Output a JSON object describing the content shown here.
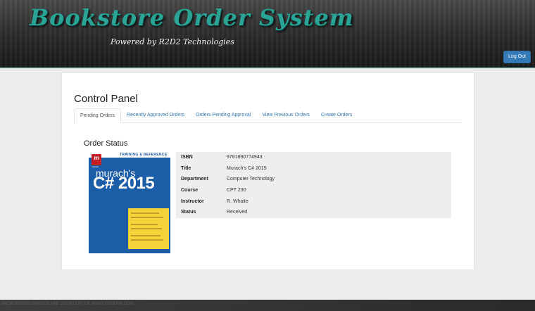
{
  "header": {
    "app_title": "Bookstore Order System",
    "tagline": "Powered by R2D2 Technologies",
    "logout_label": "Log Out"
  },
  "panel": {
    "title": "Control Panel",
    "tabs": [
      {
        "label": "Pending Orders",
        "active": true
      },
      {
        "label": "Recently Approved Orders",
        "active": false
      },
      {
        "label": "Orders Pending Approval",
        "active": false
      },
      {
        "label": "View Previous Orders",
        "active": false
      },
      {
        "label": "Create Orders",
        "active": false
      }
    ]
  },
  "order_status": {
    "title": "Order Status",
    "cover": {
      "band": "TRAINING & REFERENCE",
      "publisher": "murach",
      "title_line1": "murach's",
      "title_line2": "C# 2015"
    },
    "fields": [
      {
        "key": "ISBN",
        "value": "9781890774943"
      },
      {
        "key": "Title",
        "value": "Murach's C# 2015"
      },
      {
        "key": "Department",
        "value": "Computer Technology"
      },
      {
        "key": "Course",
        "value": "CPT 230"
      },
      {
        "key": "Instructor",
        "value": "R. Whaite"
      },
      {
        "key": "Status",
        "value": "Received"
      }
    ]
  },
  "footer": {
    "credit": "BACKGROUND IMAGES ARE COURTESY OF WWW.FREEPIK.COM"
  }
}
